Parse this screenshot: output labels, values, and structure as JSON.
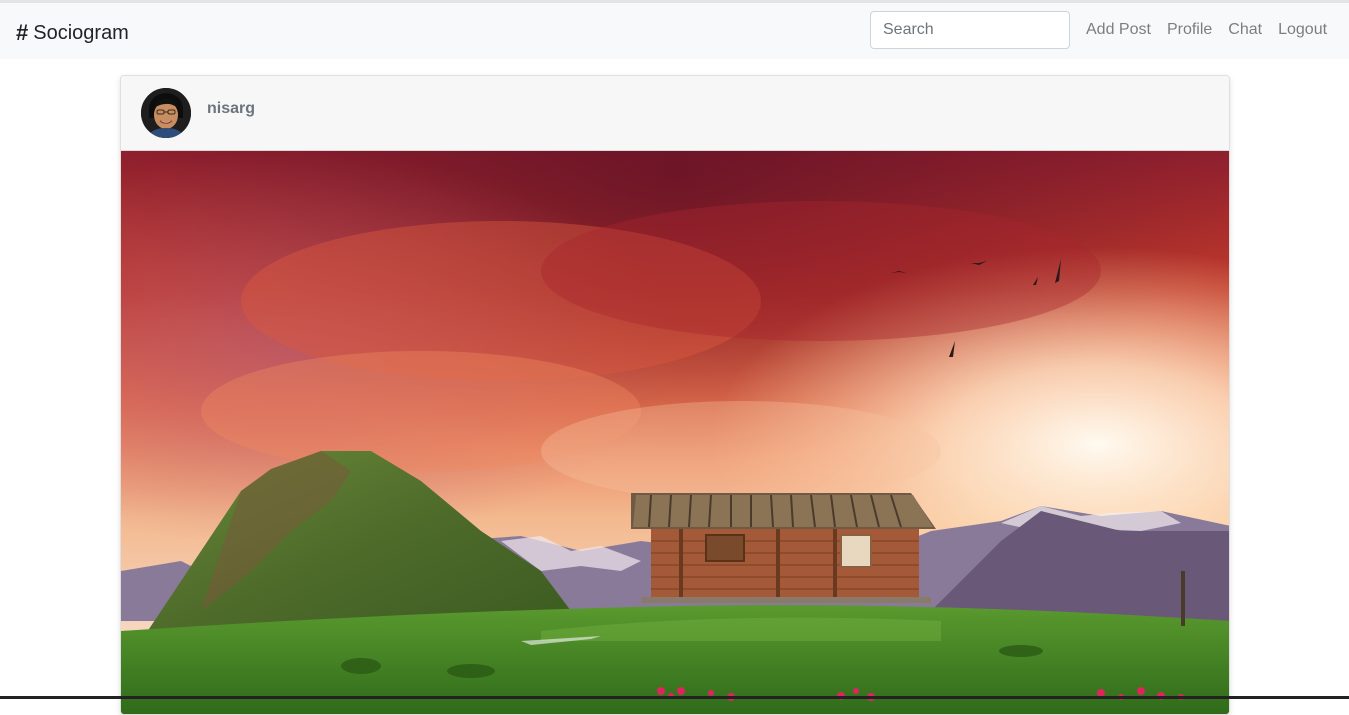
{
  "navbar": {
    "brand_icon": "hash-icon",
    "brand_name": "Sociogram",
    "search": {
      "placeholder": "Search",
      "value": ""
    },
    "links": [
      {
        "label": "Add Post"
      },
      {
        "label": "Profile"
      },
      {
        "label": "Chat"
      },
      {
        "label": "Logout"
      }
    ]
  },
  "post": {
    "username": "nisarg",
    "avatar": "profile-photo",
    "image": "landscape-cabin-sunset-photo"
  },
  "colors": {
    "navbar_bg": "#f8f9fa",
    "card_header_bg": "#f7f7f7",
    "username": "#6c757d",
    "nav_link": "#808080"
  }
}
